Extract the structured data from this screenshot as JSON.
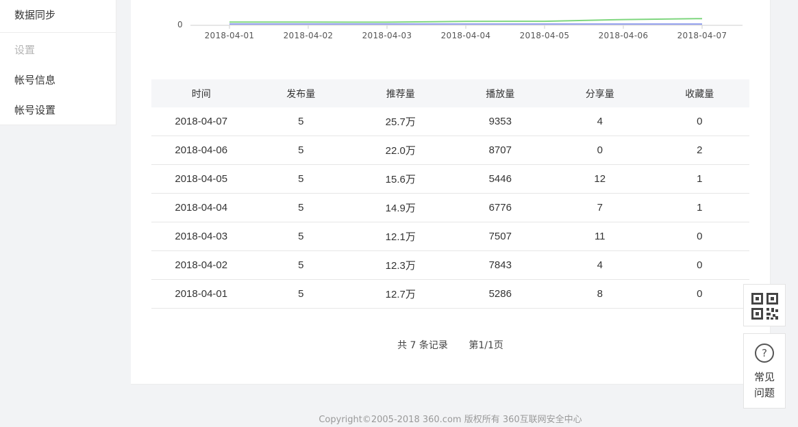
{
  "sidebar": {
    "items": [
      {
        "label": "数据同步"
      },
      {
        "label": "设置"
      },
      {
        "label": "帐号信息"
      },
      {
        "label": "帐号设置"
      }
    ]
  },
  "chart_data": {
    "type": "line",
    "x": [
      "2018-04-01",
      "2018-04-02",
      "2018-04-03",
      "2018-04-04",
      "2018-04-05",
      "2018-04-06",
      "2018-04-07"
    ],
    "y_tick_label": "0",
    "series": [
      {
        "color": "#7ed67e",
        "values": [
          12.7,
          12.3,
          12.1,
          14.9,
          15.6,
          22.0,
          25.7
        ]
      },
      {
        "color": "#6f7fe6",
        "values": [
          5,
          5,
          5,
          5,
          5,
          5,
          5
        ]
      }
    ]
  },
  "table": {
    "headers": [
      "时间",
      "发布量",
      "推荐量",
      "播放量",
      "分享量",
      "收藏量"
    ],
    "rows": [
      [
        "2018-04-07",
        "5",
        "25.7万",
        "9353",
        "4",
        "0"
      ],
      [
        "2018-04-06",
        "5",
        "22.0万",
        "8707",
        "0",
        "2"
      ],
      [
        "2018-04-05",
        "5",
        "15.6万",
        "5446",
        "12",
        "1"
      ],
      [
        "2018-04-04",
        "5",
        "14.9万",
        "6776",
        "7",
        "1"
      ],
      [
        "2018-04-03",
        "5",
        "12.1万",
        "7507",
        "11",
        "0"
      ],
      [
        "2018-04-02",
        "5",
        "12.3万",
        "7843",
        "4",
        "0"
      ],
      [
        "2018-04-01",
        "5",
        "12.7万",
        "5286",
        "8",
        "0"
      ]
    ]
  },
  "pager": {
    "total": "共 7 条记录",
    "page": "第1/1页"
  },
  "float": {
    "qr_icon": "qr-code-icon",
    "faq_icon_glyph": "?",
    "faq_line1": "常见",
    "faq_line2": "问题"
  },
  "footer": {
    "copyright": "Copyright©2005-2018 360.com 版权所有 360互联网安全中心"
  }
}
